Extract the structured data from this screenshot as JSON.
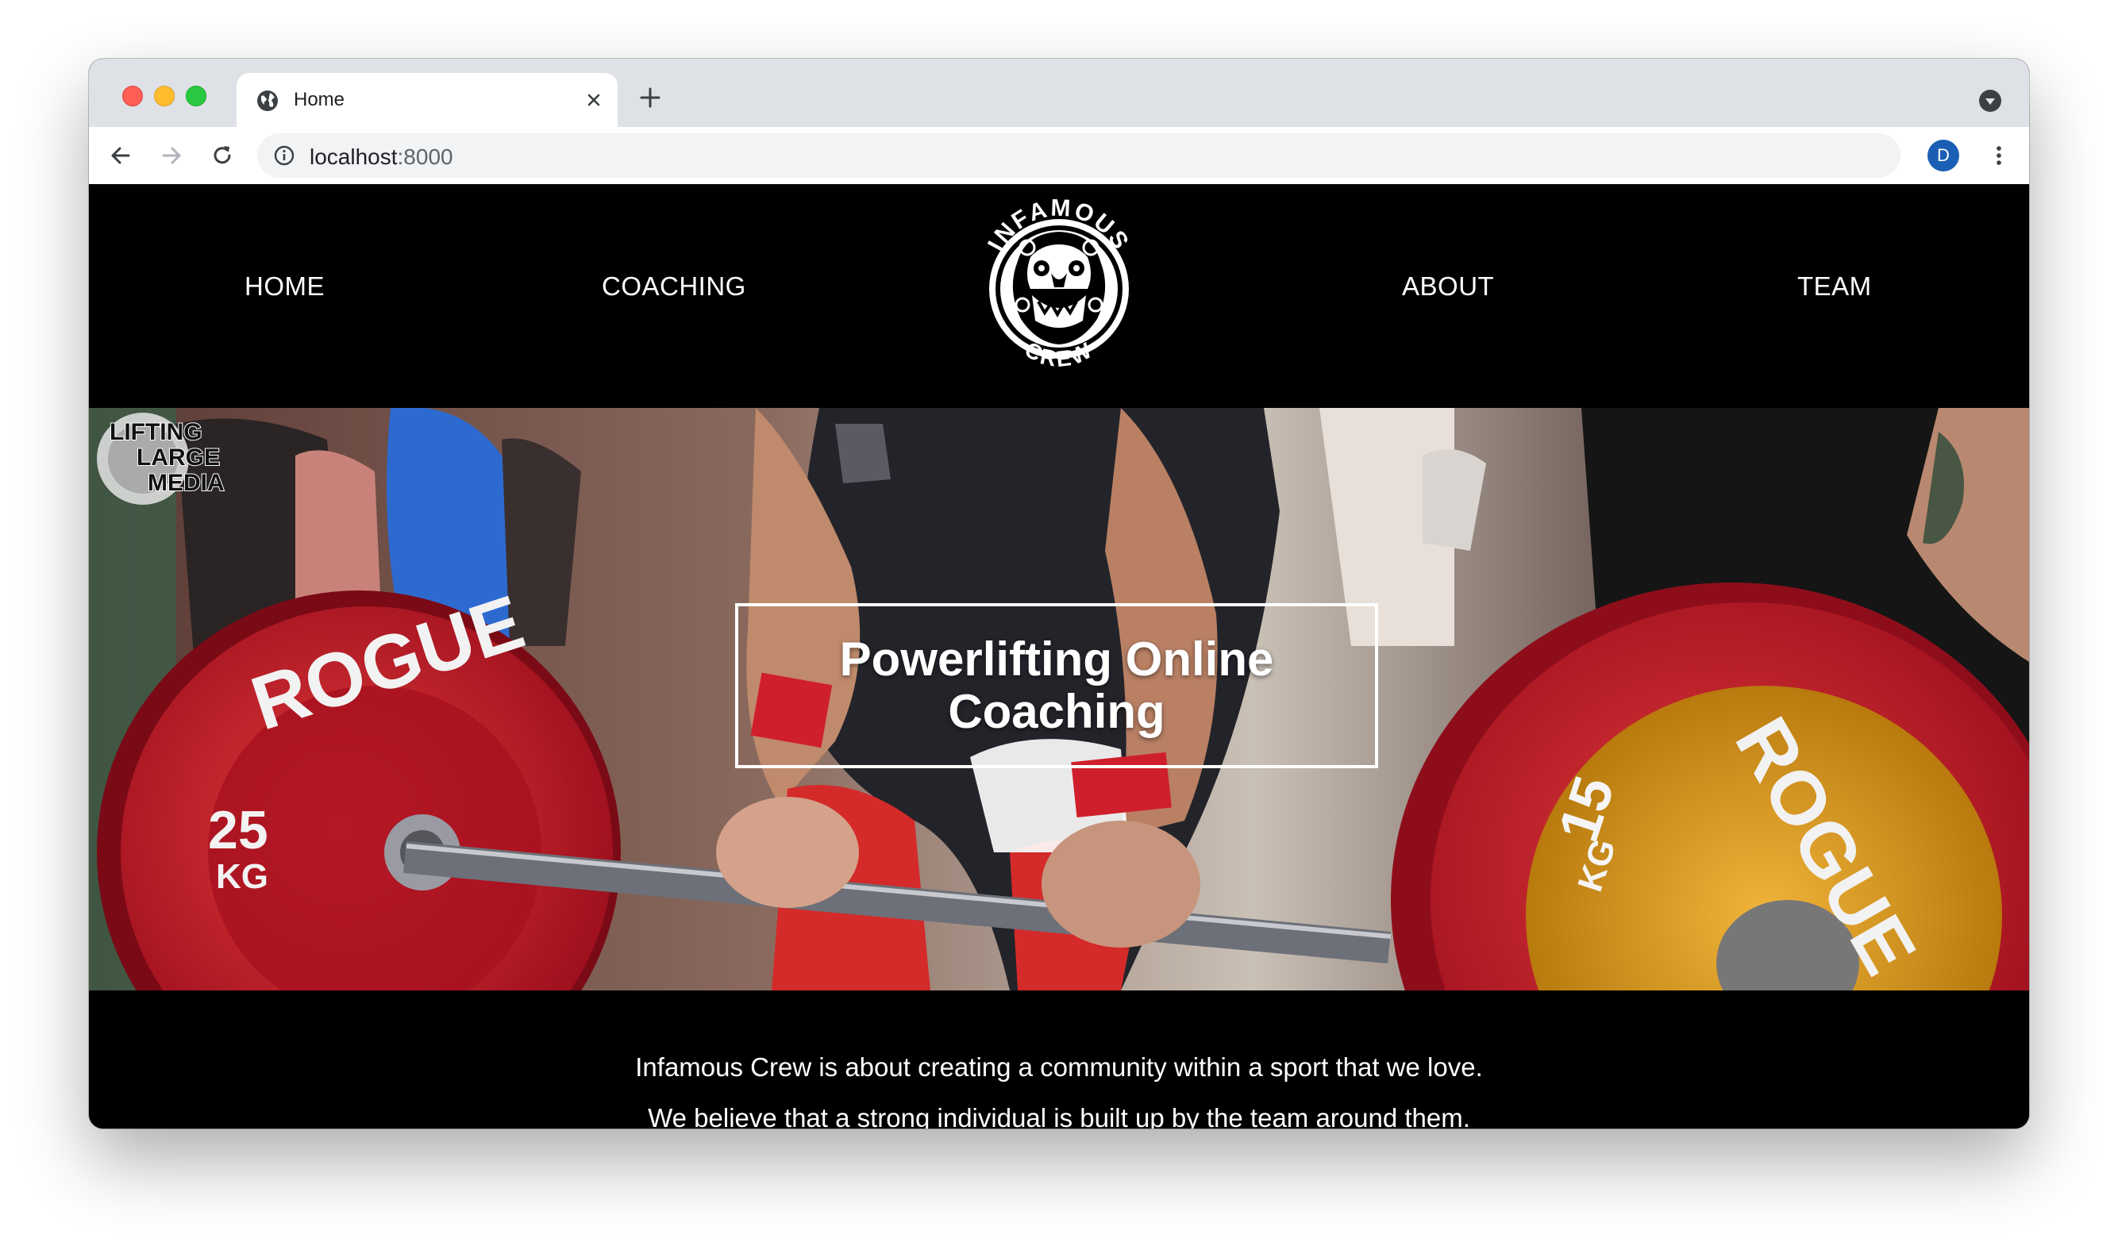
{
  "browser": {
    "tab_title": "Home",
    "url_host": "localhost",
    "url_port": ":8000",
    "profile_initial": "D"
  },
  "site": {
    "nav": {
      "home": "HOME",
      "coaching": "COACHING",
      "about": "ABOUT",
      "team": "TEAM"
    },
    "logo_text_top": "INFAMOUS",
    "logo_text_bottom": "CREW"
  },
  "hero": {
    "title": "Powerlifting Online Coaching",
    "plate_left_brand": "ROGUE",
    "plate_left_weight": "25",
    "plate_left_unit": "KG",
    "plate_right_brand": "ROGUE",
    "plate_right_weight": "15",
    "plate_right_unit": "KG",
    "watermark_lines": [
      "LIFTING",
      "LARGE",
      "MEDIA"
    ]
  },
  "intro": {
    "line1": "Infamous Crew is about creating a community within a sport that we love.",
    "line2": "We believe that a strong individual is built up by the team around them."
  },
  "colors": {
    "plate_red": "#c8102e",
    "plate_yellow": "#d89a18",
    "chrome_bg": "#dee1e6",
    "avatar_blue": "#1a5fb4"
  },
  "icons": [
    "globe-icon",
    "close-icon",
    "plus-icon",
    "back-arrow-icon",
    "forward-arrow-icon",
    "reload-icon",
    "info-icon",
    "star-icon",
    "kebab-menu-icon",
    "profile-dropdown-icon"
  ]
}
